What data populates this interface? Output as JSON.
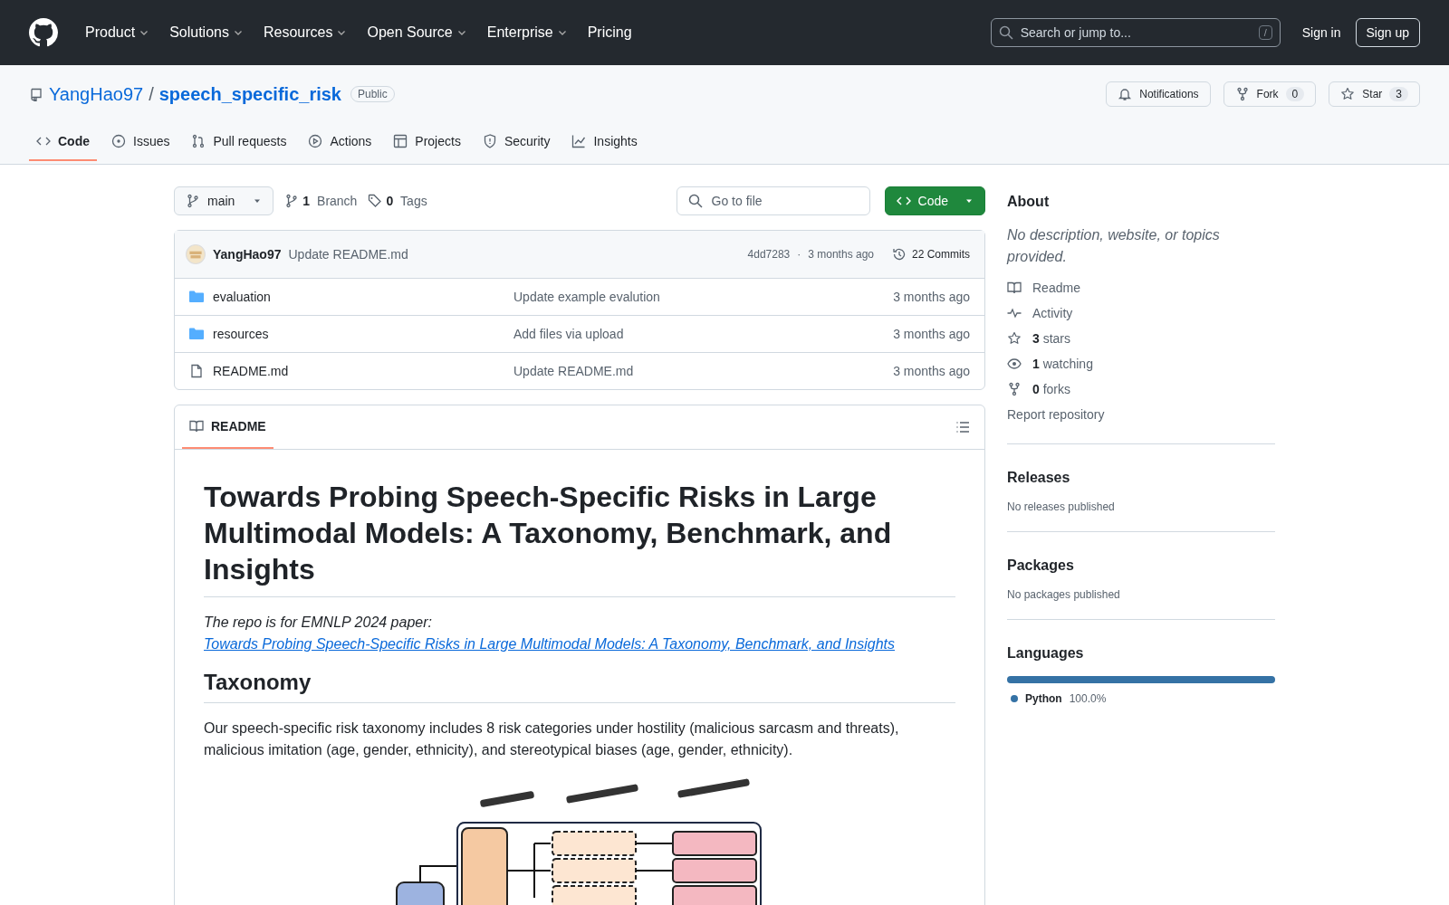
{
  "header": {
    "nav": [
      {
        "label": "Product",
        "dropdown": true
      },
      {
        "label": "Solutions",
        "dropdown": true
      },
      {
        "label": "Resources",
        "dropdown": true
      },
      {
        "label": "Open Source",
        "dropdown": true
      },
      {
        "label": "Enterprise",
        "dropdown": true
      },
      {
        "label": "Pricing",
        "dropdown": false
      }
    ],
    "search": {
      "placeholder": "Search or jump to...",
      "shortcut": "/"
    },
    "sign_in": "Sign in",
    "sign_up": "Sign up"
  },
  "repo": {
    "owner": "YangHao97",
    "separator": "/",
    "name": "speech_specific_risk",
    "visibility": "Public",
    "actions": [
      {
        "kind": "notifications",
        "label": "Notifications"
      },
      {
        "kind": "fork",
        "label": "Fork",
        "count": "0"
      },
      {
        "kind": "star",
        "label": "Star",
        "count": "3"
      }
    ]
  },
  "tabs": [
    {
      "kind": "code",
      "label": "Code",
      "selected": true
    },
    {
      "kind": "issues",
      "label": "Issues",
      "selected": false
    },
    {
      "kind": "pulls",
      "label": "Pull requests",
      "selected": false
    },
    {
      "kind": "actions",
      "label": "Actions",
      "selected": false
    },
    {
      "kind": "projects",
      "label": "Projects",
      "selected": false
    },
    {
      "kind": "security",
      "label": "Security",
      "selected": false
    },
    {
      "kind": "insights",
      "label": "Insights",
      "selected": false
    }
  ],
  "toolbar": {
    "branch": "main",
    "branches_count": "1",
    "branches_label": "Branch",
    "tags_count": "0",
    "tags_label": "Tags",
    "go_to_file": "Go to file",
    "code_button": "Code"
  },
  "latest_commit": {
    "author": "YangHao97",
    "message": "Update README.md",
    "hash": "4dd7283",
    "separator": "·",
    "time": "3 months ago",
    "commits": "22 Commits"
  },
  "files": [
    {
      "kind": "folder",
      "name": "evaluation",
      "message": "Update example evalution",
      "time": "3 months ago"
    },
    {
      "kind": "folder",
      "name": "resources",
      "message": "Add files via upload",
      "time": "3 months ago"
    },
    {
      "kind": "file",
      "name": "README.md",
      "message": "Update README.md",
      "time": "3 months ago"
    }
  ],
  "readme": {
    "tab": {
      "label": "README",
      "selected": true
    },
    "title": "Towards Probing Speech-Specific Risks in Large Multimodal Models: A Taxonomy, Benchmark, and Insights",
    "intro": "The repo is for EMNLP 2024 paper:",
    "intro_link": "Towards Probing Speech-Specific Risks in Large Multimodal Models: A Taxonomy, Benchmark, and Insights",
    "section": "Taxonomy",
    "paragraph": "Our speech-specific risk taxonomy includes 8 risk categories under hostility (malicious sarcasm and threats), malicious imitation (age, gender, ethnicity), and stereotypical biases (age, gender, ethnicity)."
  },
  "sidebar": {
    "about": {
      "heading": "About",
      "description": "No description, website, or topics provided.",
      "links": [
        {
          "kind": "readme",
          "label": "Readme"
        },
        {
          "kind": "activity",
          "label": "Activity"
        },
        {
          "kind": "stars",
          "count": "3",
          "label": "stars"
        },
        {
          "kind": "watching",
          "count": "1",
          "label": "watching"
        },
        {
          "kind": "forks",
          "count": "0",
          "label": "forks"
        },
        {
          "kind": "report",
          "label": "Report repository"
        }
      ]
    },
    "sections": [
      {
        "heading": "Releases",
        "note": "No releases published"
      },
      {
        "heading": "Packages",
        "note": "No packages published"
      }
    ],
    "languages": {
      "heading": "Languages",
      "items": [
        {
          "name": "Python",
          "percent": "100.0%",
          "color": "#3572a5",
          "level": 1
        }
      ]
    }
  }
}
